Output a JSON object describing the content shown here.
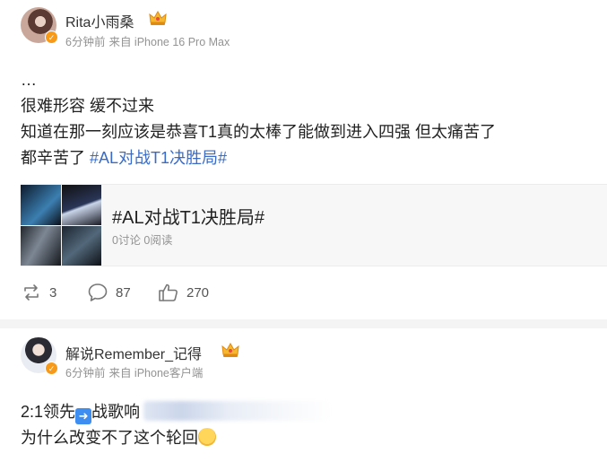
{
  "posts": [
    {
      "user": {
        "name": "Rita小雨桑"
      },
      "meta": {
        "time": "6分钟前",
        "source": "来自 iPhone 16 Pro Max"
      },
      "content": {
        "line1": "…",
        "line2": "很难形容 缓不过来",
        "line3": "知道在那一刻应该是恭喜T1真的太棒了能做到进入四强 但太痛苦了",
        "line4_text": "都辛苦了 ",
        "line4_hashtag": "#AL对战T1决胜局#"
      },
      "topic_card": {
        "title": "#AL对战T1决胜局#",
        "stats": "0讨论 0阅读"
      },
      "actions": {
        "repost_count": "3",
        "comment_count": "87",
        "like_count": "270"
      }
    },
    {
      "user": {
        "name": "解说Remember_记得"
      },
      "meta": {
        "time": "6分钟前",
        "source": "来自 iPhone客户端"
      },
      "content": {
        "line1_a": "2:1领先",
        "line1_b": "战歌响",
        "line2": "为什么改变不了这个轮回"
      }
    }
  ],
  "colors": {
    "hashtag": "#3a6cc7",
    "meta_gray": "#939393",
    "verified": "#f79a1a"
  },
  "icons": [
    "verified-badge-icon",
    "crown-icon",
    "repost-icon",
    "comment-icon",
    "like-icon",
    "arrow-right-emoji-icon",
    "crying-emoji-icon"
  ]
}
